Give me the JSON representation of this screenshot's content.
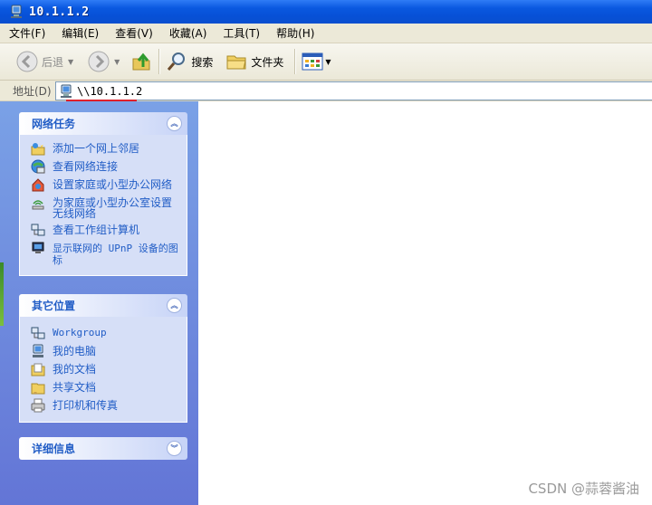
{
  "window": {
    "title": "10.1.1.2"
  },
  "menu": [
    {
      "label": "文件(F)"
    },
    {
      "label": "编辑(E)"
    },
    {
      "label": "查看(V)"
    },
    {
      "label": "收藏(A)"
    },
    {
      "label": "工具(T)"
    },
    {
      "label": "帮助(H)"
    }
  ],
  "toolbar": {
    "back_label": "后退",
    "search_label": "搜索",
    "folders_label": "文件夹"
  },
  "address": {
    "label": "地址(D)",
    "value": "\\\\10.1.1.2"
  },
  "network_tasks": {
    "title": "网络任务",
    "items": [
      {
        "label": "添加一个网上邻居",
        "icon": "add-network-place-icon"
      },
      {
        "label": "查看网络连接",
        "icon": "network-connections-icon"
      },
      {
        "label": "设置家庭或小型办公网络",
        "icon": "home-network-icon"
      },
      {
        "label": "为家庭或小型办公室设置无线网络",
        "icon": "wireless-network-icon"
      },
      {
        "label": "查看工作组计算机",
        "icon": "workgroup-computers-icon"
      },
      {
        "label": "显示联网的 UPnP 设备的图标",
        "icon": "upnp-device-icon"
      }
    ]
  },
  "other_places": {
    "title": "其它位置",
    "items": [
      {
        "label": "Workgroup",
        "icon": "workgroup-icon"
      },
      {
        "label": "我的电脑",
        "icon": "my-computer-icon"
      },
      {
        "label": "我的文档",
        "icon": "my-documents-icon"
      },
      {
        "label": "共享文档",
        "icon": "shared-documents-icon"
      },
      {
        "label": "打印机和传真",
        "icon": "printers-faxes-icon"
      }
    ]
  },
  "details": {
    "title": "详细信息"
  },
  "watermark": "CSDN @蒜蓉酱油",
  "colors": {
    "titlebar": "#0a58e0",
    "taskpane": "#7aa1e6",
    "link": "#215dc6",
    "underline": "#e0202a"
  }
}
